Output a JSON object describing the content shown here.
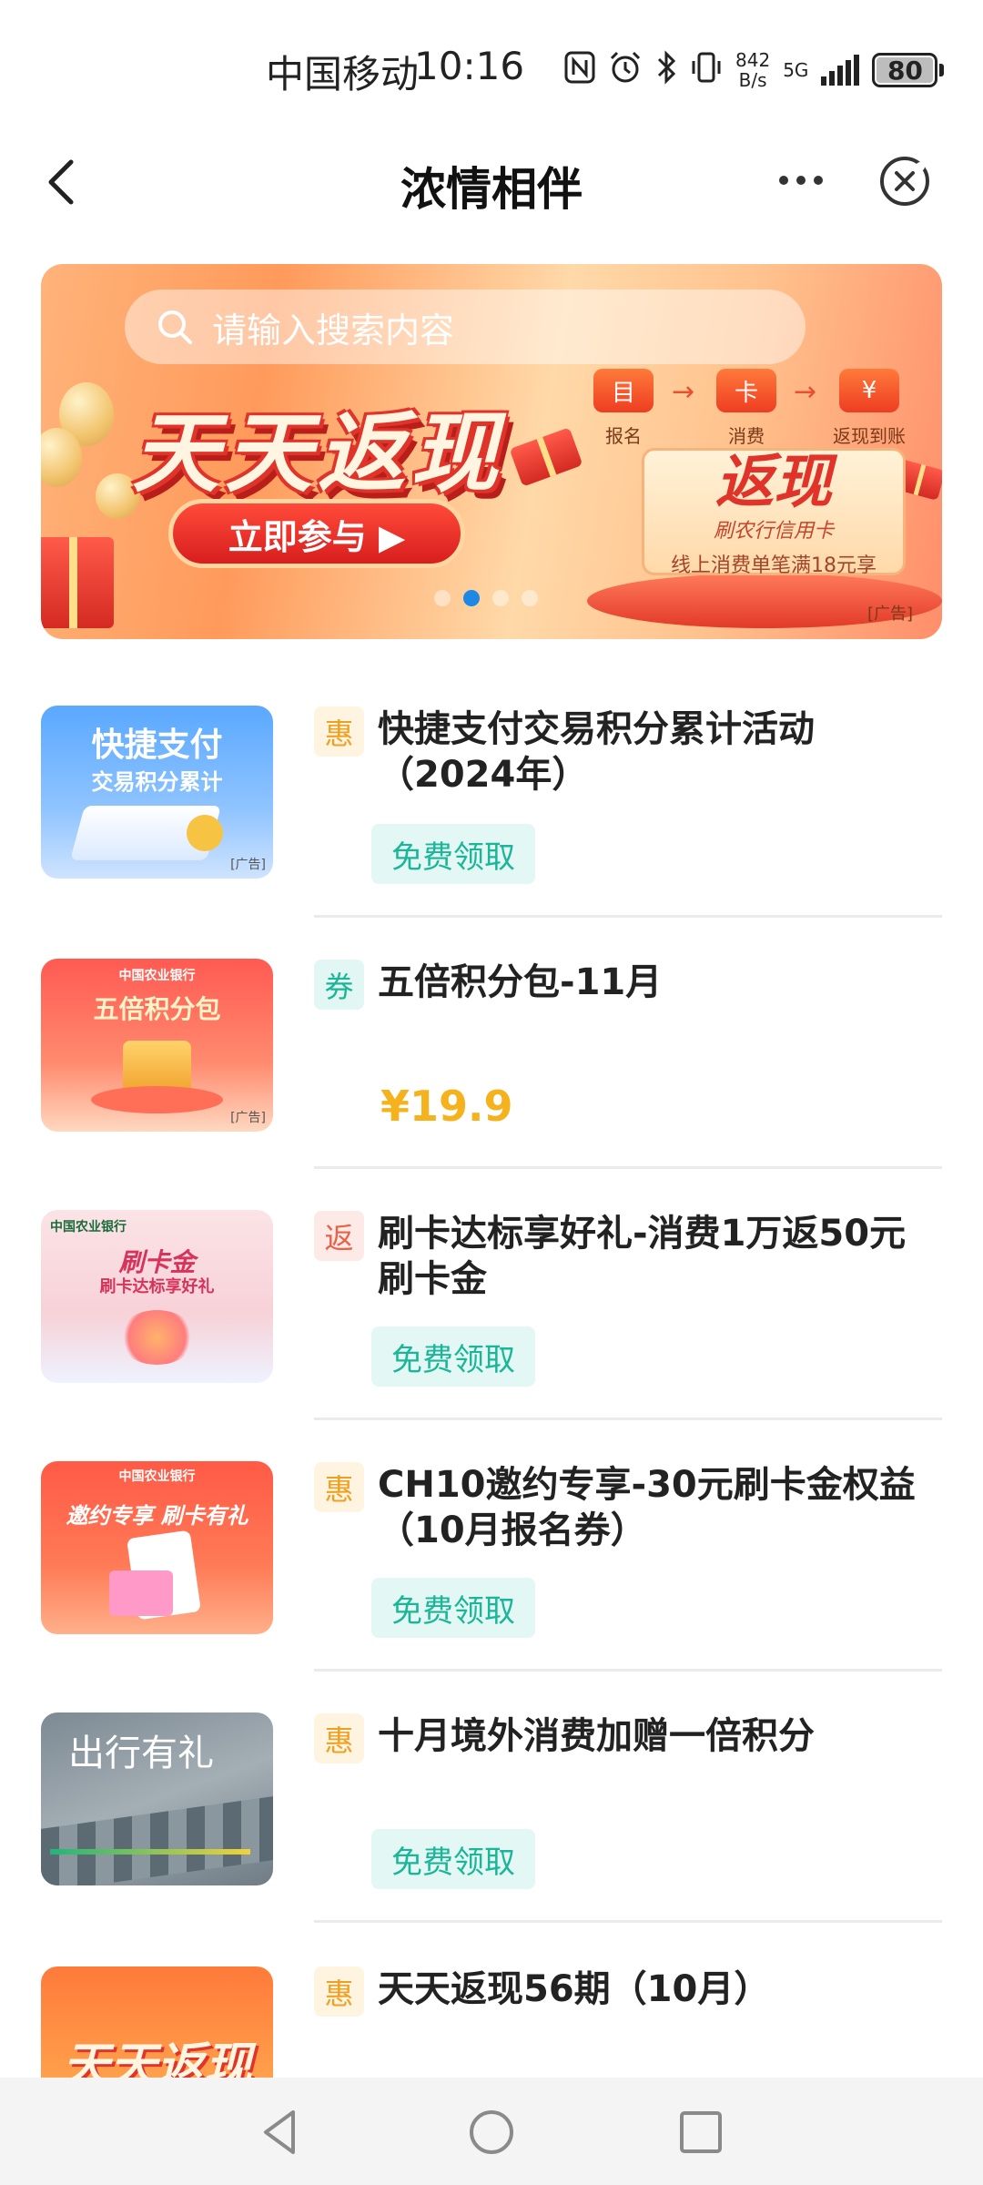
{
  "status_bar": {
    "carrier": "中国移动",
    "time": "10:16",
    "net_speed_value": "842",
    "net_speed_unit": "B/s",
    "network": "5G",
    "battery": "80"
  },
  "nav": {
    "title": "浓情相伴"
  },
  "banner": {
    "search_placeholder": "请输入搜索内容",
    "headline": "天天返现",
    "cta": "立即参与 ▶",
    "steps": [
      "报名",
      "消费",
      "返现到账"
    ],
    "step_icons": [
      "目",
      "卡",
      "¥"
    ],
    "podium_title": "返现",
    "podium_sub": "刷农行信用卡",
    "podium_note": "线上消费单笔满18元享",
    "ad_tag": "[广告]",
    "active_dot": 1
  },
  "thumb_texts": {
    "item1_line1": "快捷支付",
    "item1_line2": "交易积分累计",
    "item2_line1": "五倍积分包",
    "item3_line1": "刷卡金",
    "item3_line2": "刷卡达标享好礼",
    "item4_line1": "邀约专享 刷卡有礼",
    "item5_line1": "出行有礼",
    "item6_line1": "天天返现",
    "ad": "[广告]",
    "bank": "中国农业银行"
  },
  "items": [
    {
      "badge": "惠",
      "title": "快捷支付交易积分累计活动（2024年）",
      "action": "免费领取"
    },
    {
      "badge": "券",
      "title": "五倍积分包-11月",
      "price": "¥19.9"
    },
    {
      "badge": "返",
      "title": "刷卡达标享好礼-消费1万返50元刷卡金",
      "action": "免费领取"
    },
    {
      "badge": "惠",
      "title": "CH10邀约专享-30元刷卡金权益（10月报名券）",
      "action": "免费领取"
    },
    {
      "badge": "惠",
      "title": "十月境外消费加赠一倍积分",
      "action": "免费领取"
    },
    {
      "badge": "惠",
      "title": "天天返现56期（10月）"
    }
  ],
  "colors": {
    "accent_green": "#1bb598",
    "price_yellow": "#f5b21c",
    "badge_orange": "#f0a020",
    "badge_red": "#e8624a"
  }
}
